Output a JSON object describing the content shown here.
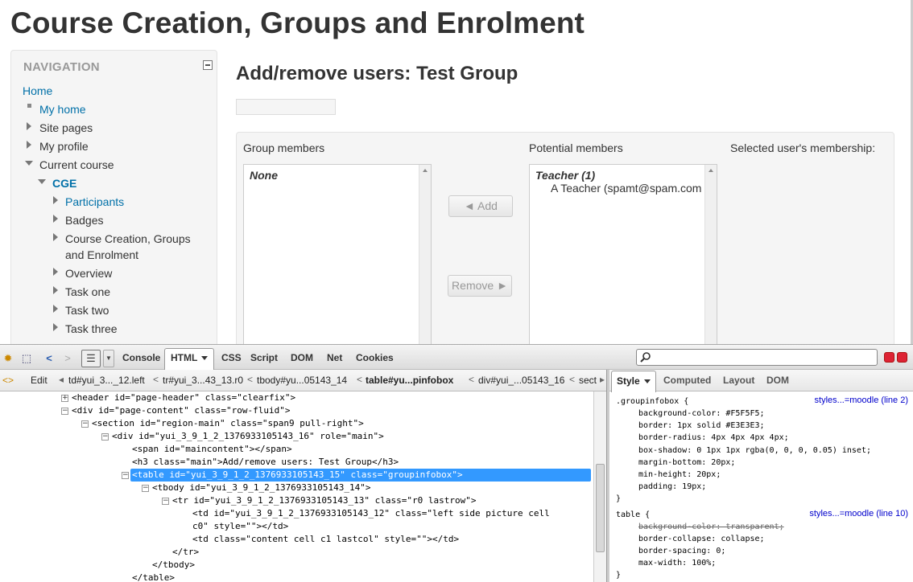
{
  "page": {
    "heading": "Course Creation, Groups and Enrolment"
  },
  "navigation": {
    "title": "NAVIGATION",
    "items": [
      {
        "label": "Home",
        "kind": "link"
      },
      {
        "label": "My home",
        "kind": "link"
      },
      {
        "label": "Site pages",
        "kind": "collapsed"
      },
      {
        "label": "My profile",
        "kind": "collapsed"
      },
      {
        "label": "Current course",
        "kind": "expanded"
      },
      {
        "label": "CGE",
        "kind": "expanded-bold-link"
      },
      {
        "label": "Participants",
        "kind": "collapsed-link"
      },
      {
        "label": "Badges",
        "kind": "collapsed"
      },
      {
        "label": "Course Creation, Groups",
        "label2": "and Enrolment",
        "kind": "collapsed"
      },
      {
        "label": "Overview",
        "kind": "collapsed"
      },
      {
        "label": "Task one",
        "kind": "collapsed"
      },
      {
        "label": "Task two",
        "kind": "collapsed"
      },
      {
        "label": "Task three",
        "kind": "collapsed"
      }
    ]
  },
  "main": {
    "title": "Add/remove users: Test Group",
    "group_members_label": "Group members",
    "group_members_empty": "None",
    "potential_members_label": "Potential members",
    "potential_group": "Teacher (1)",
    "potential_user": "A Teacher (spamt@spam.com",
    "membership_label": "Selected user's membership:",
    "add_button": "◄ Add",
    "remove_button": "Remove ►"
  },
  "firebug": {
    "tabs": [
      "Console",
      "HTML",
      "CSS",
      "Script",
      "DOM",
      "Net",
      "Cookies"
    ],
    "active_tab": "HTML",
    "edit_label": "Edit",
    "breadcrumbs": [
      "td#yui_3..._12.left",
      "tr#yui_3...43_13.r0",
      "tbody#yu...05143_14",
      "table#yu...pinfobox",
      "div#yui_...05143_16",
      "sect"
    ],
    "side_tabs": [
      "Style",
      "Computed",
      "Layout",
      "DOM"
    ],
    "active_side_tab": "Style",
    "html_lines": [
      "<header id=\"page-header\" class=\"clearfix\">",
      "<div id=\"page-content\" class=\"row-fluid\">",
      "<section id=\"region-main\" class=\"span9 pull-right\">",
      "<div id=\"yui_3_9_1_2_1376933105143_16\" role=\"main\">",
      "<span id=\"maincontent\"></span>",
      "<h3 class=\"main\">Add/remove users: Test Group</h3>",
      "<table id=\"yui_3_9_1_2_1376933105143_15\" class=\"groupinfobox\">",
      "<tbody id=\"yui_3_9_1_2_1376933105143_14\">",
      "<tr id=\"yui_3_9_1_2_1376933105143_13\" class=\"r0 lastrow\">",
      "<td id=\"yui_3_9_1_2_1376933105143_12\" class=\"left side picture cell",
      "c0\" style=\"\"></td>",
      "<td class=\"content cell c1 lastcol\" style=\"\"></td>",
      "</tr>",
      "</tbody>",
      "</table>"
    ],
    "css_rules": [
      {
        "selector": ".groupinfobox {",
        "source": "styles...=moodle (line 2)"
      },
      {
        "selector": "table {",
        "source": "styles...=moodle (line 10)"
      }
    ],
    "css_lines": [
      "background-color: #F5F5F5;",
      "border: 1px solid #E3E3E3;",
      "border-radius: 4px 4px 4px 4px;",
      "box-shadow: 0 1px 1px rgba(0, 0, 0, 0.05) inset;",
      "margin-bottom: 20px;",
      "min-height: 20px;",
      "padding: 19px;",
      "background-color: transparent;",
      "border-collapse: collapse;",
      "border-spacing: 0;",
      "max-width: 100%;"
    ],
    "close_brace": "}"
  }
}
